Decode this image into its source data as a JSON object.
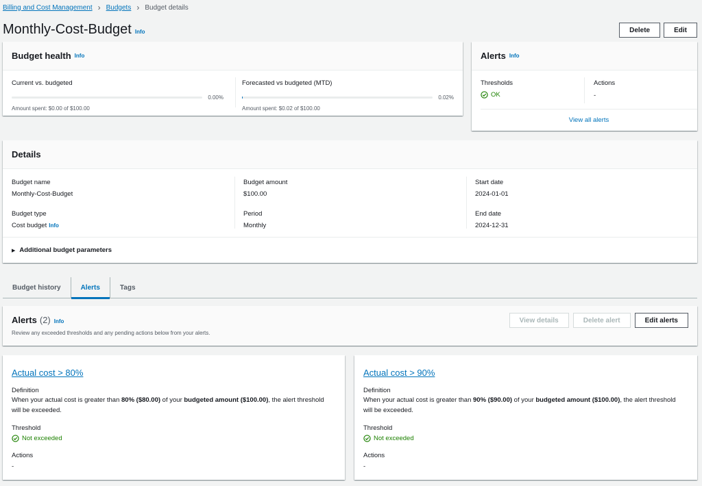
{
  "breadcrumb": {
    "root": "Billing and Cost Management",
    "budgets": "Budgets",
    "current": "Budget details"
  },
  "page": {
    "title": "Monthly-Cost-Budget",
    "info": "Info",
    "delete_label": "Delete",
    "edit_label": "Edit"
  },
  "budget_health": {
    "title": "Budget health",
    "info": "Info",
    "current": {
      "label": "Current vs. budgeted",
      "percent": "0.00%",
      "fill_fraction": 0.0,
      "amount": "Amount spent: $0.00 of $100.00"
    },
    "forecast": {
      "label": "Forecasted vs budgeted (MTD)",
      "percent": "0.02%",
      "fill_fraction": 0.0002,
      "amount": "Amount spent: $0.02 of $100.00"
    }
  },
  "alerts_summary": {
    "title": "Alerts",
    "info": "Info",
    "thresholds_label": "Thresholds",
    "thresholds_value": "OK",
    "actions_label": "Actions",
    "actions_value": "-",
    "view_all": "View all alerts"
  },
  "details": {
    "title": "Details",
    "budget_name_label": "Budget name",
    "budget_name_value": "Monthly-Cost-Budget",
    "budget_type_label": "Budget type",
    "budget_type_value": "Cost budget",
    "budget_type_info": "Info",
    "budget_amount_label": "Budget amount",
    "budget_amount_value": "$100.00",
    "period_label": "Period",
    "period_value": "Monthly",
    "start_date_label": "Start date",
    "start_date_value": "2024-01-01",
    "end_date_label": "End date",
    "end_date_value": "2024-12-31",
    "additional": "Additional budget parameters"
  },
  "tabs": [
    {
      "label": "Budget history"
    },
    {
      "label": "Alerts"
    },
    {
      "label": "Tags"
    }
  ],
  "alerts_panel": {
    "title": "Alerts",
    "count": "(2)",
    "info": "Info",
    "description": "Review any exceeded thresholds and any pending actions below from your alerts.",
    "view_details": "View details",
    "delete_alert": "Delete alert",
    "edit_alerts": "Edit alerts"
  },
  "alert_cards": [
    {
      "title": "Actual cost > 80%",
      "definition_label": "Definition",
      "def_pre": "When your actual cost is greater than ",
      "def_pct": "80% ($80.00)",
      "def_mid": " of your ",
      "def_amt": "budgeted amount ($100.00)",
      "def_post": ", the alert threshold will be exceeded.",
      "threshold_label": "Threshold",
      "threshold_value": "Not exceeded",
      "actions_label": "Actions",
      "actions_value": "-"
    },
    {
      "title": "Actual cost > 90%",
      "definition_label": "Definition",
      "def_pre": "When your actual cost is greater than ",
      "def_pct": "90% ($90.00)",
      "def_mid": " of your ",
      "def_amt": "budgeted amount ($100.00)",
      "def_post": ", the alert threshold will be exceeded.",
      "threshold_label": "Threshold",
      "threshold_value": "Not exceeded",
      "actions_label": "Actions",
      "actions_value": "-"
    }
  ],
  "colors": {
    "link": "#0073bb",
    "success": "#1d8102",
    "background": "#f2f3f3"
  }
}
